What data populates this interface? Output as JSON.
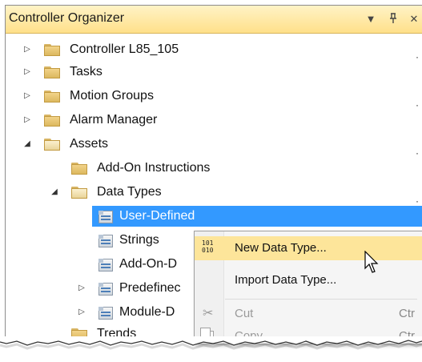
{
  "panel": {
    "title": "Controller Organizer",
    "controls": {
      "dropdown_icon": "triangle-down",
      "pin_icon": "pin",
      "close_icon": "x"
    }
  },
  "tree": {
    "items": [
      {
        "label": "Controller L85_105",
        "expander": "collapsed",
        "icon": "folder"
      },
      {
        "label": "Tasks",
        "expander": "collapsed",
        "icon": "folder"
      },
      {
        "label": "Motion Groups",
        "expander": "collapsed",
        "icon": "folder"
      },
      {
        "label": "Alarm Manager",
        "expander": "collapsed",
        "icon": "folder"
      },
      {
        "label": "Assets",
        "expander": "expanded",
        "icon": "folder-open"
      },
      {
        "label": "Add-On Instructions",
        "expander": "none",
        "icon": "folder"
      },
      {
        "label": "Data Types",
        "expander": "expanded",
        "icon": "folder-open"
      },
      {
        "label": "User-Defined",
        "expander": "none",
        "icon": "data-type",
        "selected": true
      },
      {
        "label": "Strings",
        "expander": "none",
        "icon": "data-type"
      },
      {
        "label": "Add-On-D",
        "expander": "none",
        "icon": "data-type"
      },
      {
        "label": "Predefinec",
        "expander": "collapsed",
        "icon": "data-type"
      },
      {
        "label": "Module-D",
        "expander": "collapsed",
        "icon": "data-type"
      },
      {
        "label": "Trends",
        "expander": "none",
        "icon": "folder"
      }
    ]
  },
  "context_menu": {
    "items": [
      {
        "label": "New Data Type...",
        "icon": "binary-icon",
        "state": "hover"
      },
      {
        "label": "Import Data Type...",
        "icon": "",
        "state": "normal"
      },
      {
        "label": "Cut",
        "icon": "scissors-icon",
        "shortcut": "Ctr",
        "state": "disabled"
      },
      {
        "label": "Copy",
        "icon": "copy-icon",
        "shortcut": "Ctr",
        "state": "disabled"
      }
    ],
    "binary_icon_text": "101\n010"
  },
  "colors": {
    "title_bar": "#ffe08a",
    "selection": "#3399ff",
    "menu_hover": "#fde59a"
  }
}
